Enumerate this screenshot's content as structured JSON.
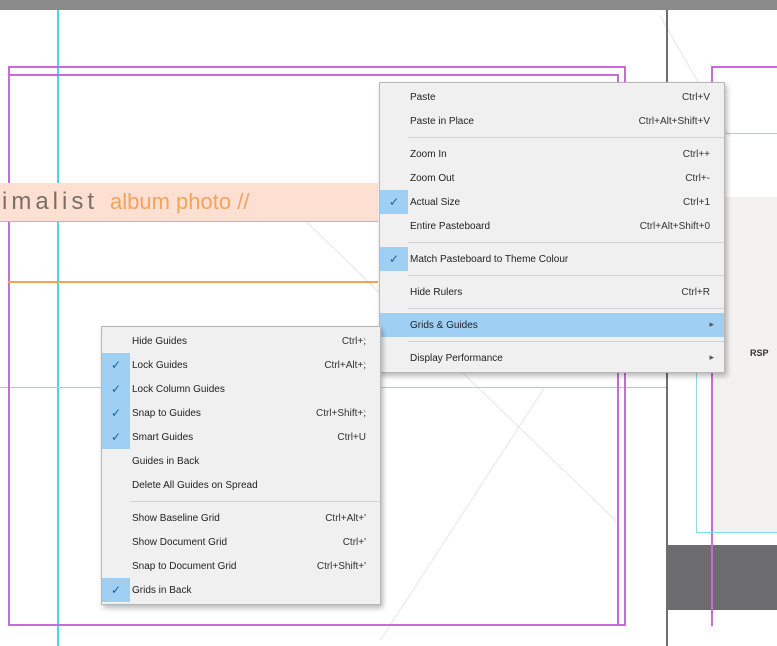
{
  "document": {
    "heading_part1": "imalist",
    "heading_part2": "album photo //",
    "right_page_label": "RSP",
    "colors": {
      "guide_cyan": "#48d7e8",
      "margin_magenta": "#c86ad9",
      "frame_fill": "#fde0d2",
      "accent_orange": "#f2a35e",
      "menu_highlight": "#9fd0f4"
    }
  },
  "context_menu": {
    "items": [
      {
        "label": "Paste",
        "shortcut": "Ctrl+V",
        "checked": false
      },
      {
        "label": "Paste in Place",
        "shortcut": "Ctrl+Alt+Shift+V",
        "checked": false
      },
      {
        "label": "Zoom In",
        "shortcut": "Ctrl++",
        "checked": false
      },
      {
        "label": "Zoom Out",
        "shortcut": "Ctrl+-",
        "checked": false
      },
      {
        "label": "Actual Size",
        "shortcut": "Ctrl+1",
        "checked": true
      },
      {
        "label": "Entire Pasteboard",
        "shortcut": "Ctrl+Alt+Shift+0",
        "checked": false
      },
      {
        "label": "Match Pasteboard to Theme Colour",
        "shortcut": "",
        "checked": true
      },
      {
        "label": "Hide Rulers",
        "shortcut": "Ctrl+R",
        "checked": false
      },
      {
        "label": "Grids & Guides",
        "shortcut": "",
        "checked": false,
        "submenu": true,
        "highlighted": true
      },
      {
        "label": "Display Performance",
        "shortcut": "",
        "checked": false,
        "submenu": true
      }
    ]
  },
  "guides_submenu": {
    "items": [
      {
        "label": "Hide Guides",
        "shortcut": "Ctrl+;",
        "checked": false
      },
      {
        "label": "Lock Guides",
        "shortcut": "Ctrl+Alt+;",
        "checked": true
      },
      {
        "label": "Lock Column Guides",
        "shortcut": "",
        "checked": true
      },
      {
        "label": "Snap to Guides",
        "shortcut": "Ctrl+Shift+;",
        "checked": true
      },
      {
        "label": "Smart Guides",
        "shortcut": "Ctrl+U",
        "checked": true
      },
      {
        "label": "Guides in Back",
        "shortcut": "",
        "checked": false
      },
      {
        "label": "Delete All Guides on Spread",
        "shortcut": "",
        "checked": false
      },
      {
        "label": "Show Baseline Grid",
        "shortcut": "Ctrl+Alt+'",
        "checked": false
      },
      {
        "label": "Show Document Grid",
        "shortcut": "Ctrl+'",
        "checked": false
      },
      {
        "label": "Snap to Document Grid",
        "shortcut": "Ctrl+Shift+'",
        "checked": false
      },
      {
        "label": "Grids in Back",
        "shortcut": "",
        "checked": true
      }
    ]
  }
}
